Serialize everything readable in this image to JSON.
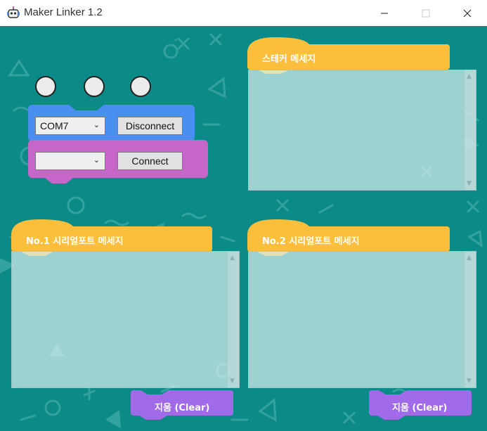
{
  "window": {
    "title": "Maker Linker 1.2",
    "minimize_icon": "minimize-icon",
    "maximize_icon": "maximize-icon",
    "close_icon": "close-icon"
  },
  "colors": {
    "background": "#0c8a87",
    "panel_header": "#fbbf3b",
    "port1_block": "#4a8ff0",
    "port2_block": "#c766c9",
    "clear_button": "#a06ae8",
    "led": "#ececec"
  },
  "status_leds": [
    {
      "name": "led-1",
      "state": "off"
    },
    {
      "name": "led-2",
      "state": "off"
    },
    {
      "name": "led-3",
      "state": "off"
    }
  ],
  "port1": {
    "selected": "COM7",
    "button_label": "Disconnect"
  },
  "port2": {
    "selected": "",
    "button_label": "Connect"
  },
  "panels": {
    "sticker": {
      "title": "스테커 메세지",
      "content": ""
    },
    "serial1": {
      "title": "No.1 시리얼포트 메세지",
      "content": ""
    },
    "serial2": {
      "title": "No.2 시리얼포트 메세지",
      "content": ""
    }
  },
  "clear_buttons": {
    "left_label": "지움 (Clear)",
    "right_label": "지움 (Clear)"
  }
}
